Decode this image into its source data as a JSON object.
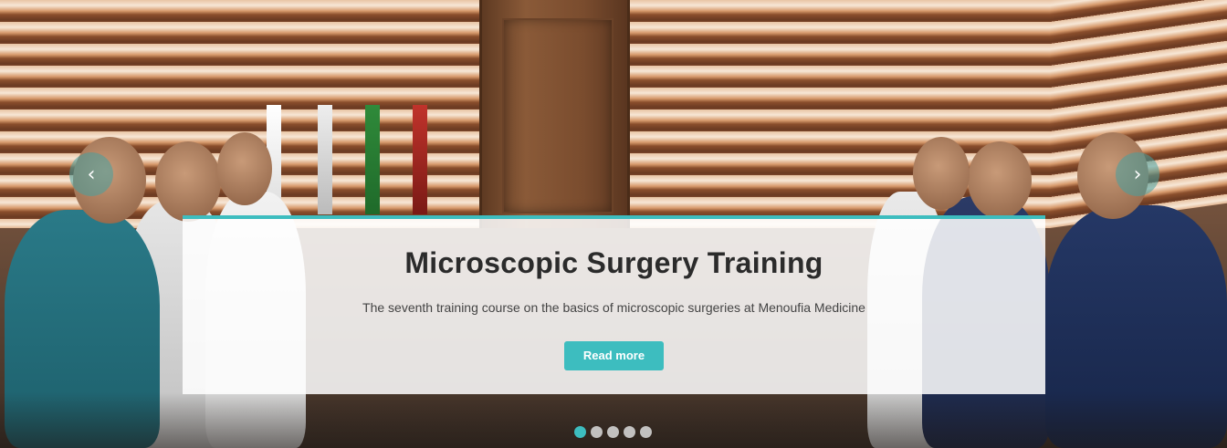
{
  "slide": {
    "title": "Microscopic Surgery Training",
    "subtitle": "The seventh training course on the basics of microscopic surgeries at Menoufia Medicine",
    "read_more_label": "Read more"
  },
  "controls": {
    "prev_icon": "chevron-left-icon",
    "next_icon": "chevron-right-icon",
    "prev_glyph": "‹",
    "next_glyph": "›"
  },
  "indicators": {
    "count": 5,
    "active_index": 0
  },
  "colors": {
    "accent": "#3dbdbf",
    "title_text": "#2b2b2b"
  }
}
